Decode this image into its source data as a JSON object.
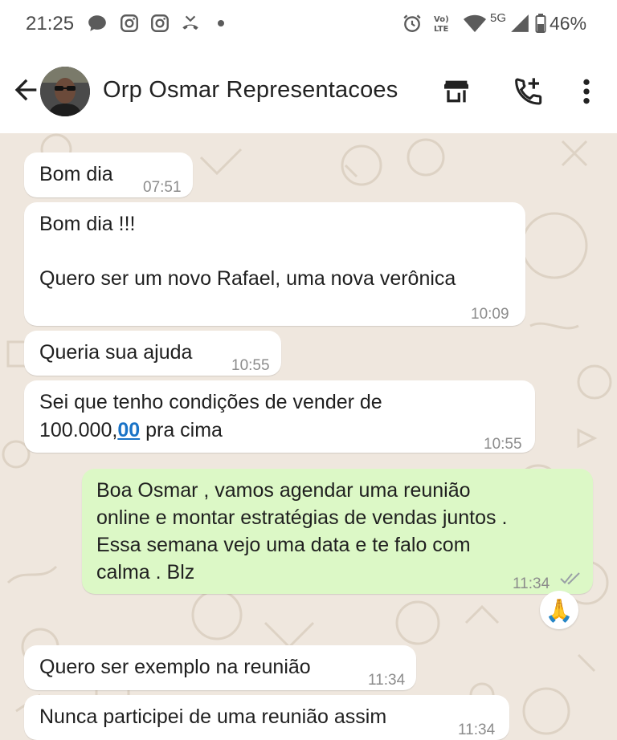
{
  "status_bar": {
    "time": "21:25",
    "network": "5G",
    "battery": "46%",
    "icons": [
      "message-bubble-icon",
      "instagram-icon",
      "instagram-icon",
      "missed-call-icon",
      "dot-icon",
      "alarm-icon",
      "volte-icon",
      "wifi-icon",
      "signal-icon",
      "battery-icon"
    ]
  },
  "header": {
    "contact_name": "Orp Osmar Representacoes",
    "icons": [
      "back-arrow-icon",
      "store-icon",
      "add-call-icon",
      "more-vert-icon"
    ]
  },
  "colors": {
    "chat_background": "#efe7de",
    "incoming_bubble": "#ffffff",
    "outgoing_bubble": "#dcf8c6",
    "link": "#1a73c7",
    "read_ticks": "#9aa0a6"
  },
  "messages": [
    {
      "direction": "in",
      "text": "Bom dia",
      "time": "07:51"
    },
    {
      "direction": "in",
      "lines": [
        "Bom dia !!!",
        "",
        "Quero ser um novo Rafael, uma nova verônica"
      ],
      "time": "10:09"
    },
    {
      "direction": "in",
      "text": "Queria sua ajuda",
      "time": "10:55"
    },
    {
      "direction": "in",
      "line1": "Sei que tenho condições de vender de",
      "line2_prefix": "100.000,",
      "line2_link": "00",
      "line2_suffix": " pra cima",
      "time": "10:55"
    },
    {
      "direction": "out",
      "lines": [
        "Boa Osmar , vamos agendar uma reunião",
        "online e montar estratégias de vendas juntos .",
        "Essa semana vejo uma data e te falo com",
        "calma . Blz"
      ],
      "time": "11:34",
      "status": "read",
      "reaction": "🙏"
    },
    {
      "direction": "in",
      "text": "Quero ser exemplo na reunião",
      "time": "11:34"
    },
    {
      "direction": "in",
      "text": "Nunca participei de uma reunião assim",
      "time": "11:34"
    }
  ]
}
